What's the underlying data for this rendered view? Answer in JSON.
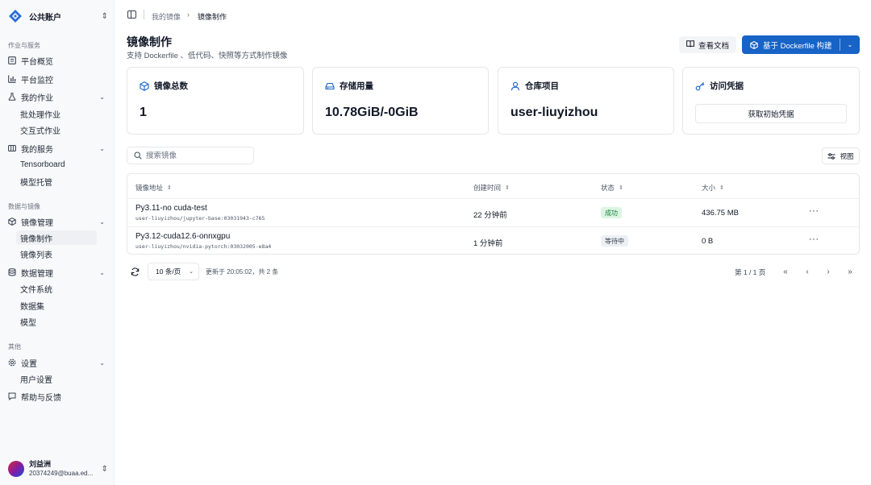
{
  "sidebar": {
    "account": "公共账户",
    "sections": {
      "work": "作业与服务",
      "data": "数据与镜像",
      "other": "其他"
    },
    "items": {
      "overview": "平台概览",
      "monitor": "平台监控",
      "jobs": "我的作业",
      "jobs_batch": "批处理作业",
      "jobs_interactive": "交互式作业",
      "services": "我的服务",
      "services_tensorboard": "Tensorboard",
      "services_model": "模型托管",
      "image_mgmt": "镜像管理",
      "image_build": "镜像制作",
      "image_list": "镜像列表",
      "data_mgmt": "数据管理",
      "data_fs": "文件系统",
      "data_dataset": "数据集",
      "data_model": "模型",
      "settings": "设置",
      "settings_user": "用户设置",
      "help": "帮助与反馈"
    },
    "user": {
      "name": "刘益洲",
      "email": "20374249@buaa.ed..."
    }
  },
  "breadcrumb": {
    "parent": "我的镜像",
    "current": "镜像制作"
  },
  "header": {
    "title": "镜像制作",
    "subtitle": "支持 Dockerfile 、低代码、快照等方式制作镜像",
    "docs_label": "查看文档",
    "build_label": "基于 Dockerfile 构建"
  },
  "cards": {
    "total": {
      "label": "镜像总数",
      "value": "1"
    },
    "storage": {
      "label": "存储用量",
      "value": "10.78GiB/-0GiB"
    },
    "repo": {
      "label": "仓库项目",
      "value": "user-liuyizhou"
    },
    "credential": {
      "label": "访问凭据",
      "button": "获取初始凭据"
    }
  },
  "search": {
    "placeholder": "搜索镜像"
  },
  "view_label": "视图",
  "table": {
    "headers": {
      "address": "镜像地址",
      "created": "创建时间",
      "status": "状态",
      "size": "大小"
    },
    "rows": [
      {
        "name": "Py3.11-no cuda-test",
        "address": "user-liuyizhou/jupyter-base:03031943-c765",
        "created": "22 分钟前",
        "status": "成功",
        "size": "436.75 MB"
      },
      {
        "name": "Py3.12-cuda12.6-onnxgpu",
        "address": "user-liuyizhou/nvidia-pytorch:03032005-e8a4",
        "created": "1 分钟前",
        "status": "等待中",
        "size": "0 B"
      }
    ]
  },
  "footer": {
    "page_size": "10 条/页",
    "updated": "更新于 20:05:02，共 2 条",
    "page_info": "第 1 / 1 页"
  },
  "colors": {
    "primary": "#1763c6",
    "success_bg": "#dcf5e3",
    "success_text": "#15803d"
  }
}
